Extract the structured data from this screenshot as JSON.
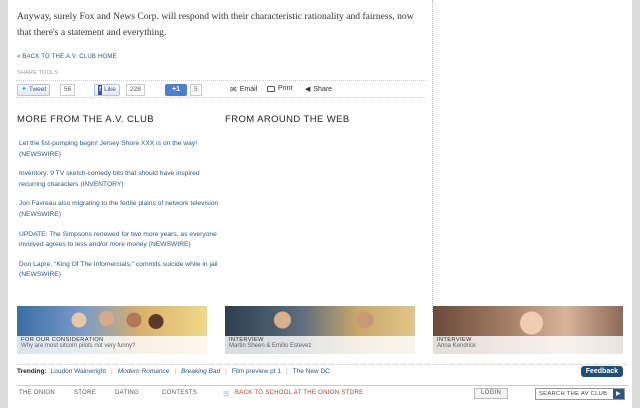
{
  "article": {
    "closing_text": "Anyway, surely Fox and News Corp. will respond with their characteristic rationality and fairness, now that there's a statement and everything.",
    "back_link": "« BACK TO THE A.V. CLUB HOME",
    "share_tools_label": "SHARE TOOLS"
  },
  "share": {
    "tweet_label": "Tweet",
    "tweet_count": "56",
    "like_label": "Like",
    "like_count": "228",
    "plus_label": "+1",
    "plus_count": "5",
    "email_label": "Email",
    "print_label": "Print",
    "share_label": "Share"
  },
  "more_section": {
    "title": "MORE FROM THE A.V. CLUB",
    "items": [
      {
        "text": "Let the fist-pumping begin! Jersey Shore XXX is on the way!",
        "tag": "(NEWSWIRE)"
      },
      {
        "text": "Inventory: 9 TV sketch-comedy bits that should have inspired recurring characters",
        "tag": "(INVENTORY)"
      },
      {
        "text": "Jon Favreau also migrating to the fertile plains of network television",
        "tag": "(NEWSWIRE)"
      },
      {
        "text": "UPDATE: The Simpsons renewed for two more years, as everyone involved agrees to less and/or more money",
        "tag": "(NEWSWIRE)"
      },
      {
        "text": "Don Lapre, \"King Of The Infomercials,\" commits suicide while in jail",
        "tag": "(NEWSWIRE)"
      }
    ]
  },
  "around_section": {
    "title": "FROM AROUND THE WEB"
  },
  "tiles": [
    {
      "kicker": "FOR OUR CONSIDERATION",
      "subtitle": "Why are most sitcom pilots not very funny?"
    },
    {
      "kicker": "INTERVIEW",
      "subtitle": "Martin Sheen & Emilio Estevez"
    },
    {
      "kicker": "INTERVIEW",
      "subtitle": "Anna Kendrick"
    }
  ],
  "trending": {
    "label": "Trending:",
    "items": [
      "Loudon Wainwright",
      "Modern Romance",
      "Breaking Bad",
      "Film preview pt 1",
      "The New DC"
    ]
  },
  "feedback_label": "Feedback",
  "footer": {
    "links": [
      "THE ONION",
      "STORE",
      "DATING",
      "CONTESTS"
    ],
    "promo": "BACK TO SCHOOL AT THE ONION STORE",
    "login": "LOGIN",
    "search_label": "SEARCH THE AV CLUB"
  },
  "colors": {
    "link": "#2a5a8a",
    "feedback": "#1f4e79",
    "promo": "#c0392b"
  }
}
